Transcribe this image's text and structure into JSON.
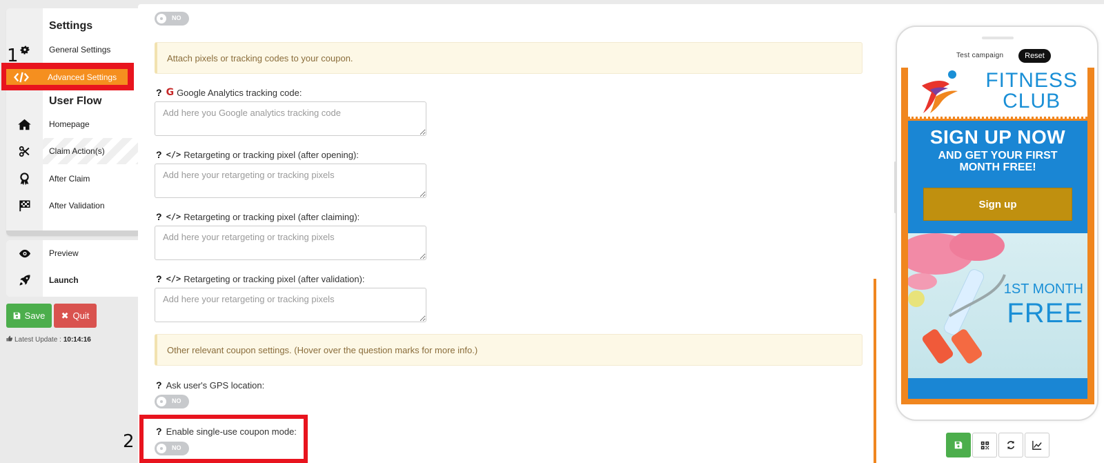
{
  "sidebar": {
    "settings_heading": "Settings",
    "user_flow_heading": "User Flow",
    "items": [
      {
        "label": "General Settings",
        "icon": "gear-icon"
      },
      {
        "label": "Advanced Settings",
        "icon": "code-icon"
      },
      {
        "label": "Homepage",
        "icon": "home-icon"
      },
      {
        "label": "Claim Action(s)",
        "icon": "scissors-icon"
      },
      {
        "label": "After Claim",
        "icon": "award-icon"
      },
      {
        "label": "After Validation",
        "icon": "checkered-flag-icon"
      }
    ],
    "secondary_items": [
      {
        "label": "Preview",
        "icon": "eye-icon"
      },
      {
        "label": "Launch",
        "icon": "rocket-icon"
      }
    ],
    "save_label": "Save",
    "quit_label": "Quit",
    "last_update_label": "Latest Update :",
    "last_update_time": "10:14:16"
  },
  "annotations": {
    "mark1": "1",
    "mark2": "2"
  },
  "main": {
    "top_toggle": "NO",
    "tracking_notice": "Attach pixels or tracking codes to your coupon.",
    "fields": [
      {
        "label": "Google Analytics tracking code:",
        "placeholder": "Add here you Google analytics tracking code"
      },
      {
        "label": "Retargeting or tracking pixel (after opening):",
        "placeholder": "Add here your retargeting or tracking pixels"
      },
      {
        "label": "Retargeting or tracking pixel (after claiming):",
        "placeholder": "Add here your retargeting or tracking pixels"
      },
      {
        "label": "Retargeting or tracking pixel (after validation):",
        "placeholder": "Add here your retargeting or tracking pixels"
      }
    ],
    "other_notice": "Other relevant coupon settings. (Hover over the question marks for more info.)",
    "gps_label": "Ask user's GPS location:",
    "gps_toggle": "NO",
    "single_use_label": "Enable single-use coupon mode:",
    "single_use_toggle": "NO"
  },
  "preview": {
    "campaign_name": "Test campaign",
    "reset_label": "Reset",
    "logo_line1": "FITNESS",
    "logo_line2": "CLUB",
    "headline": "SIGN UP NOW",
    "subheadline": "AND GET YOUR FIRST MONTH FREE!",
    "button_label": "Sign up",
    "promo_small": "1ST MONTH",
    "promo_big": "FREE"
  },
  "colors": {
    "accent_orange": "#f58f1f",
    "highlight_red": "#e8141e",
    "save_green": "#4cae4c",
    "quit_red": "#d9534f",
    "brand_blue": "#1a86d4"
  }
}
